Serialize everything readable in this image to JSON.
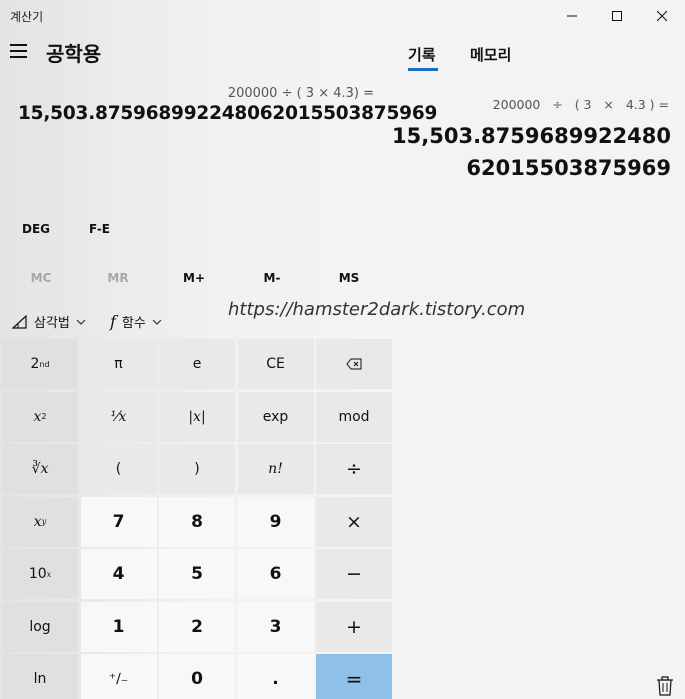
{
  "window": {
    "title": "계산기"
  },
  "header": {
    "mode_title": "공학용"
  },
  "display": {
    "expression": "200000 ÷ ( 3 × 4.3) =",
    "result": "15,503.87596899224806201550387596 9"
  },
  "settings": {
    "deg_label": "DEG",
    "fe_label": "F-E"
  },
  "memory": {
    "mc": "MC",
    "mr": "MR",
    "mplus": "M+",
    "mminus": "M-",
    "ms": "MS"
  },
  "function_bar": {
    "trig_label": "삼각법",
    "func_label": "함수",
    "func_icon_glyph": "f"
  },
  "watermark": "https://hamster2dark.tistory.com",
  "keypad": {
    "second": "2",
    "second_sup": "nd",
    "pi": "π",
    "e": "e",
    "ce": "CE",
    "x2_base": "x",
    "x2_sup": "2",
    "reciprocal": "⅟x",
    "abs": "|x|",
    "exp": "exp",
    "mod": "mod",
    "root_y": "∛x",
    "lparen": "(",
    "rparen": ")",
    "fact": "n!",
    "divide": "÷",
    "xy_base": "x",
    "xy_sup": "y",
    "n7": "7",
    "n8": "8",
    "n9": "9",
    "multiply": "×",
    "ten_base": "10",
    "ten_sup": "x",
    "n4": "4",
    "n5": "5",
    "n6": "6",
    "minus": "−",
    "log": "log",
    "n1": "1",
    "n2": "2",
    "n3": "3",
    "plus": "+",
    "ln": "ln",
    "negate": "⁺∕₋",
    "n0": "0",
    "dot": ".",
    "equals": "="
  },
  "history": {
    "tab_history": "기록",
    "tab_memory": "메모리",
    "expression": "200000   ÷   ( 3   ×   4.3 ) =",
    "result_line1": "15,503.8759689922480",
    "result_line2": "62015503875969"
  }
}
